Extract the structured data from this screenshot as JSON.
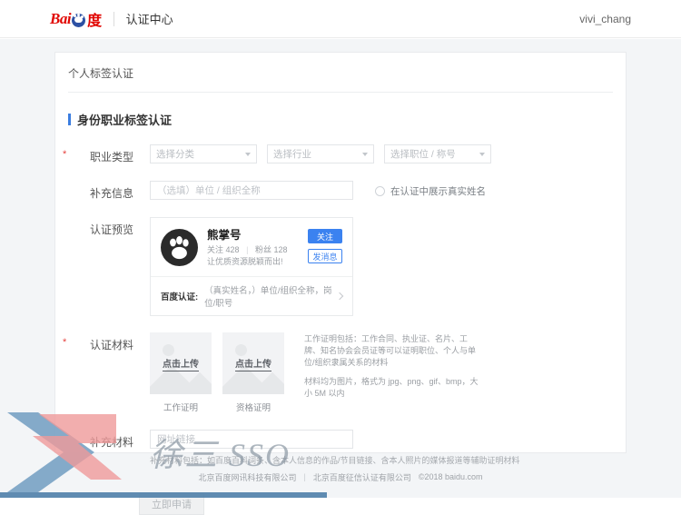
{
  "header": {
    "logo_alt": "Baidu",
    "logo_text_left": "Bai",
    "logo_text_right": "度",
    "site_title": "认证中心",
    "username": "vivi_chang"
  },
  "breadcrumb": "个人标签认证",
  "section": {
    "title": "身份职业标签认证",
    "accent_color": "#3b7de0"
  },
  "fields": {
    "occupation": {
      "label": "职业类型",
      "required": true,
      "selects": [
        {
          "name": "category",
          "value": "选择分类"
        },
        {
          "name": "industry",
          "value": "选择行业"
        },
        {
          "name": "position",
          "value": "选择职位 / 称号"
        }
      ]
    },
    "extra_info": {
      "label": "补充信息",
      "required": false,
      "placeholder": "（选填）单位 / 组织全称",
      "value": "",
      "checkbox_label": "在认证中展示真实姓名",
      "checkbox_checked": false
    },
    "preview": {
      "label": "认证预览",
      "card": {
        "avatar_icon": "paw-icon",
        "name": "熊掌号",
        "follow_label": "关注",
        "follow_count": "428",
        "fans_label": "粉丝",
        "fans_count": "128",
        "slogan": "让优质资源脱颖而出!",
        "btn_follow": "关注",
        "btn_message": "发消息",
        "cert_label": "百度认证:",
        "cert_value": "（真实姓名，）单位/组织全称，岗位/职号",
        "btn_follow_color": "#3b82f0"
      }
    },
    "materials": {
      "label": "认证材料",
      "required": true,
      "uploads": [
        {
          "button_text": "点击上传",
          "caption": "工作证明"
        },
        {
          "button_text": "点击上传",
          "caption": "资格证明"
        }
      ],
      "help_line1": "工作证明包括：工作合同、执业证、名片、工牌、知名协会会员证等可以证明职位、个人与单位/组织隶属关系的材料",
      "help_line2": "材料均为图片，格式为 jpg、png、gif、bmp，大小 5M 以内"
    },
    "extra_materials": {
      "label": "补充材料",
      "required": false,
      "placeholder": "网址链接",
      "value": "",
      "hint": "补充材料包括：如百度百科词条、含本人信息的作品/节目链接、含本人照片的媒体报道等辅助证明材料"
    }
  },
  "submit_button": {
    "label": "立即申请",
    "disabled": true
  },
  "footer": {
    "company1": "北京百度网讯科技有限公司",
    "company2": "北京百度征信认证有限公司",
    "copyright": "©2018 baidu.com"
  },
  "watermark": {
    "text": "徐三 SSO",
    "logo_alt": "x-chevron-logo",
    "blue": "#7ba3c4",
    "red": "#ef9a9a"
  }
}
